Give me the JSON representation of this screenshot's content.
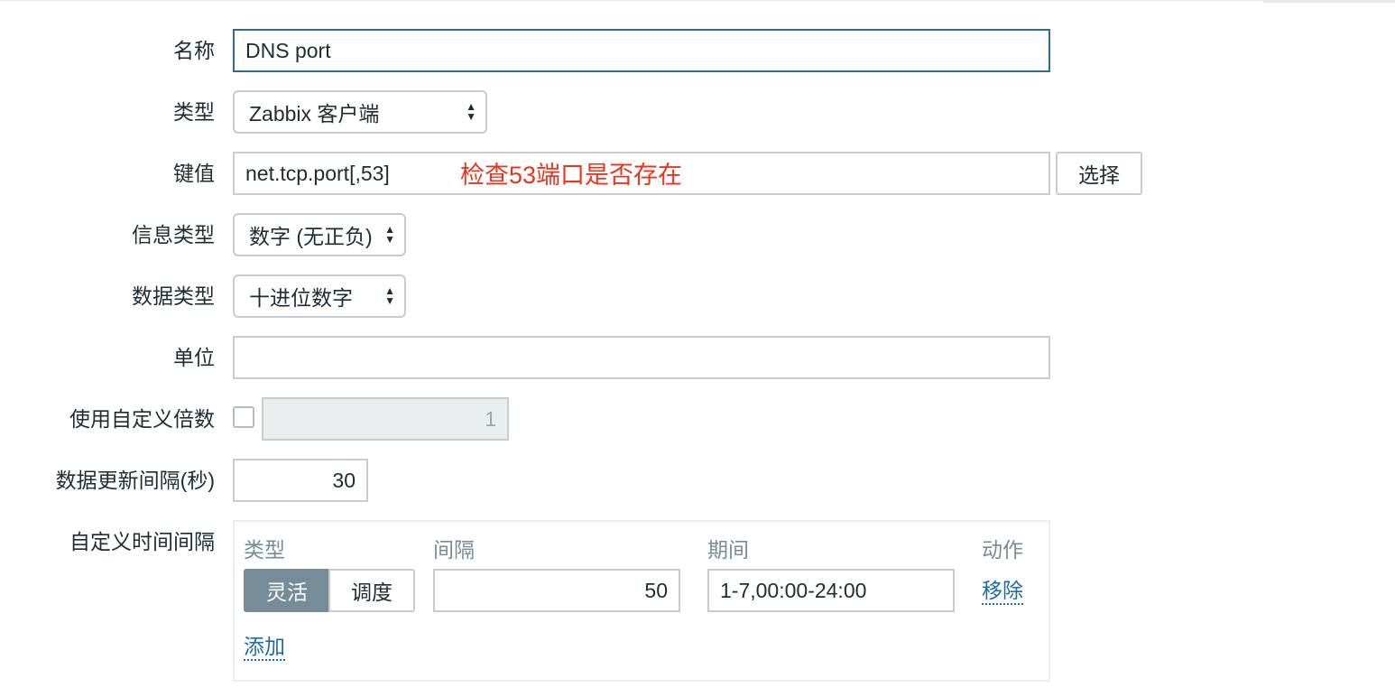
{
  "form": {
    "name": {
      "label": "名称",
      "value": "DNS port"
    },
    "type": {
      "label": "类型",
      "value": "Zabbix 客户端"
    },
    "key": {
      "label": "键值",
      "value": "net.tcp.port[,53]",
      "select_button": "选择",
      "annotation": "检查53端口是否存在"
    },
    "info_type": {
      "label": "信息类型",
      "value": "数字 (无正负)"
    },
    "data_type": {
      "label": "数据类型",
      "value": "十进位数字"
    },
    "units": {
      "label": "单位",
      "value": ""
    },
    "multiplier": {
      "label": "使用自定义倍数",
      "checked": false,
      "value": "1"
    },
    "update_interval": {
      "label": "数据更新间隔(秒)",
      "value": "30"
    },
    "custom_intervals": {
      "label": "自定义时间间隔",
      "columns": {
        "type": "类型",
        "interval": "间隔",
        "period": "期间",
        "action": "动作"
      },
      "row": {
        "mode_flexible": "灵活",
        "mode_scheduling": "调度",
        "interval": "50",
        "period": "1-7,00:00-24:00",
        "remove": "移除"
      },
      "add": "添加"
    }
  },
  "colors": {
    "annotation": "#e8351f",
    "link": "#1f6ba0",
    "active_segment": "#768d99",
    "focus_border": "#2f6d8a"
  },
  "icons": {
    "select_arrows": "up-down-triangle-icon"
  }
}
